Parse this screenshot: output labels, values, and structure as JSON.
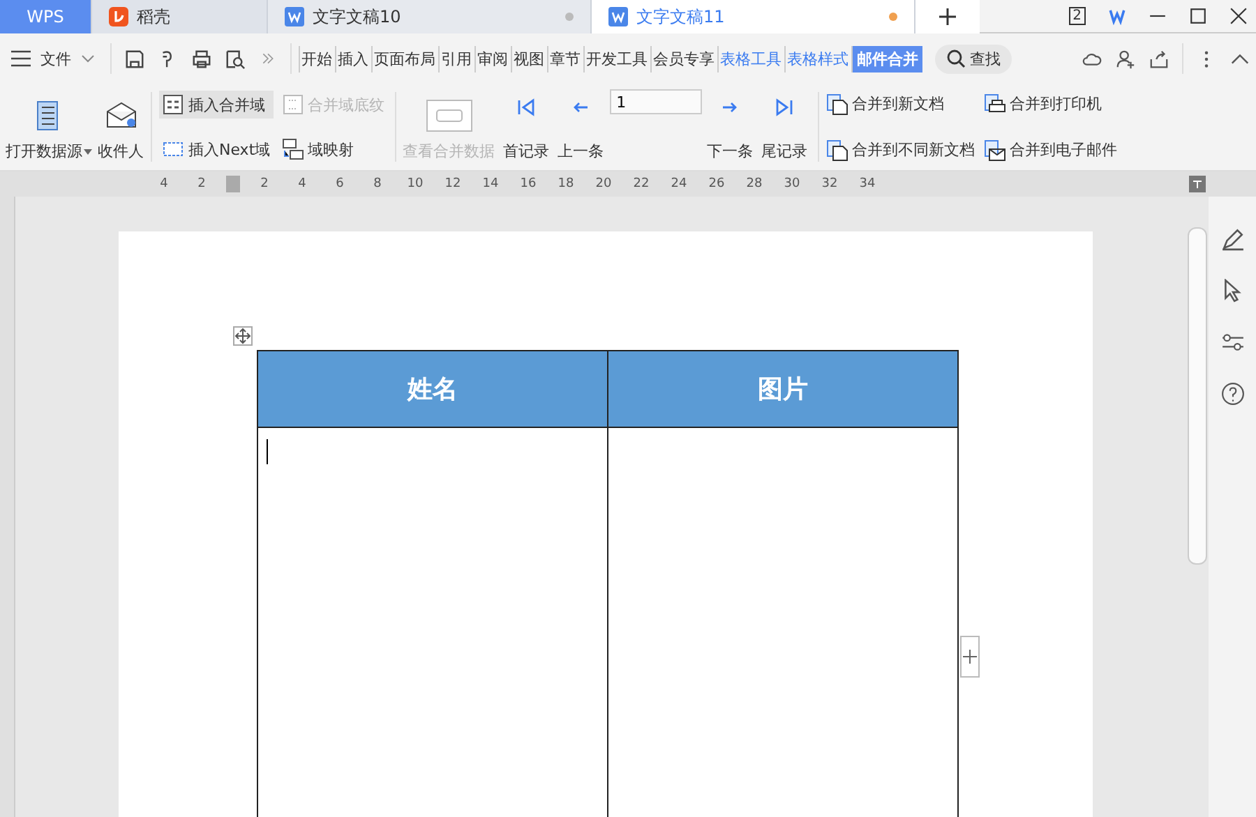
{
  "tabs": [
    {
      "kind": "brand",
      "label": "WPS",
      "selected": false
    },
    {
      "kind": "docer",
      "label": "稻壳",
      "selected": false
    },
    {
      "kind": "doc",
      "label": "文字文稿10",
      "selected": false
    },
    {
      "kind": "doc",
      "label": "文字文稿11",
      "selected": true
    }
  ],
  "window": {
    "badge": "2"
  },
  "file_menu": "文件",
  "ribbon_tabs": [
    {
      "label": "开始",
      "contextual": false,
      "selected": false
    },
    {
      "label": "插入",
      "contextual": false,
      "selected": false
    },
    {
      "label": "页面布局",
      "contextual": false,
      "selected": false
    },
    {
      "label": "引用",
      "contextual": false,
      "selected": false
    },
    {
      "label": "审阅",
      "contextual": false,
      "selected": false
    },
    {
      "label": "视图",
      "contextual": false,
      "selected": false
    },
    {
      "label": "章节",
      "contextual": false,
      "selected": false
    },
    {
      "label": "开发工具",
      "contextual": false,
      "selected": false
    },
    {
      "label": "会员专享",
      "contextual": false,
      "selected": false
    },
    {
      "label": "表格工具",
      "contextual": true,
      "selected": false
    },
    {
      "label": "表格样式",
      "contextual": true,
      "selected": false
    },
    {
      "label": "邮件合并",
      "contextual": false,
      "selected": true
    }
  ],
  "search": {
    "label": "查找"
  },
  "ribbon": {
    "data_source": {
      "label": "打开数据源"
    },
    "recipients": {
      "label": "收件人"
    },
    "fields": [
      {
        "label": "插入合并域",
        "disabled": false
      },
      {
        "label": "合并域底纹",
        "disabled": true
      },
      {
        "label": "插入Next域",
        "disabled": false
      },
      {
        "label": "域映射",
        "disabled": false
      }
    ],
    "view_merged": {
      "label": "查看合并数据",
      "disabled": true
    },
    "first": {
      "label": "首记录"
    },
    "prev": {
      "label": "上一条"
    },
    "record": {
      "value": "1"
    },
    "next": {
      "label": "下一条"
    },
    "last": {
      "label": "尾记录"
    },
    "outputs": [
      {
        "label": "合并到新文档"
      },
      {
        "label": "合并到打印机"
      },
      {
        "label": "合并到不同新文档"
      },
      {
        "label": "合并到电子邮件"
      }
    ]
  },
  "ruler": {
    "left_labels": [
      "4",
      "2"
    ],
    "labels": [
      "2",
      "4",
      "6",
      "8",
      "10",
      "12",
      "14",
      "16",
      "18",
      "20",
      "22",
      "24",
      "26",
      "28",
      "30",
      "32",
      "34"
    ]
  },
  "table": {
    "columns": [
      "姓名",
      "图片"
    ]
  }
}
